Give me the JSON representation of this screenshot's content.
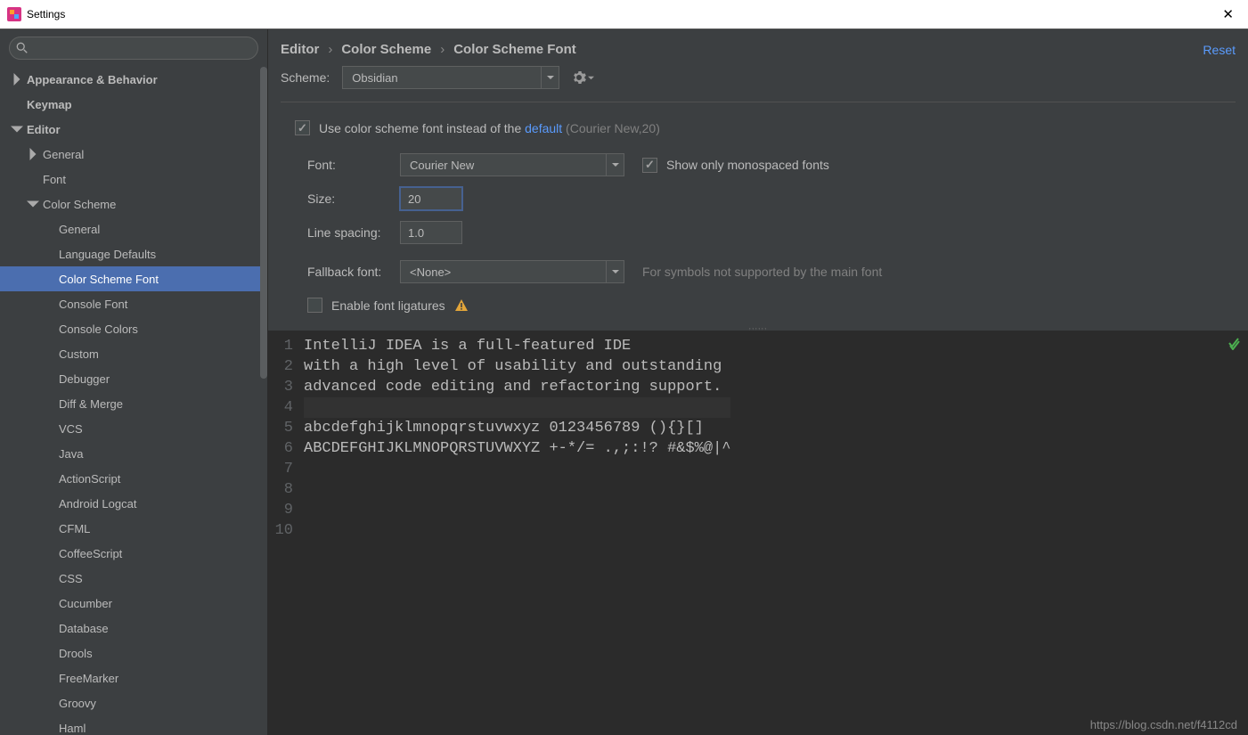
{
  "window": {
    "title": "Settings"
  },
  "sidebar": {
    "items": [
      {
        "label": "Appearance & Behavior",
        "indent": 0,
        "bold": true,
        "arrow": "right"
      },
      {
        "label": "Keymap",
        "indent": 0,
        "bold": true,
        "arrow": "none"
      },
      {
        "label": "Editor",
        "indent": 0,
        "bold": true,
        "arrow": "down"
      },
      {
        "label": "General",
        "indent": 1,
        "bold": false,
        "arrow": "right"
      },
      {
        "label": "Font",
        "indent": 1,
        "bold": false,
        "arrow": "none"
      },
      {
        "label": "Color Scheme",
        "indent": 1,
        "bold": false,
        "arrow": "down"
      },
      {
        "label": "General",
        "indent": 2,
        "bold": false,
        "arrow": "none"
      },
      {
        "label": "Language Defaults",
        "indent": 2,
        "bold": false,
        "arrow": "none"
      },
      {
        "label": "Color Scheme Font",
        "indent": 2,
        "bold": false,
        "arrow": "none",
        "selected": true
      },
      {
        "label": "Console Font",
        "indent": 2,
        "bold": false,
        "arrow": "none"
      },
      {
        "label": "Console Colors",
        "indent": 2,
        "bold": false,
        "arrow": "none"
      },
      {
        "label": "Custom",
        "indent": 2,
        "bold": false,
        "arrow": "none"
      },
      {
        "label": "Debugger",
        "indent": 2,
        "bold": false,
        "arrow": "none"
      },
      {
        "label": "Diff & Merge",
        "indent": 2,
        "bold": false,
        "arrow": "none"
      },
      {
        "label": "VCS",
        "indent": 2,
        "bold": false,
        "arrow": "none"
      },
      {
        "label": "Java",
        "indent": 2,
        "bold": false,
        "arrow": "none"
      },
      {
        "label": "ActionScript",
        "indent": 2,
        "bold": false,
        "arrow": "none"
      },
      {
        "label": "Android Logcat",
        "indent": 2,
        "bold": false,
        "arrow": "none"
      },
      {
        "label": "CFML",
        "indent": 2,
        "bold": false,
        "arrow": "none"
      },
      {
        "label": "CoffeeScript",
        "indent": 2,
        "bold": false,
        "arrow": "none"
      },
      {
        "label": "CSS",
        "indent": 2,
        "bold": false,
        "arrow": "none"
      },
      {
        "label": "Cucumber",
        "indent": 2,
        "bold": false,
        "arrow": "none"
      },
      {
        "label": "Database",
        "indent": 2,
        "bold": false,
        "arrow": "none"
      },
      {
        "label": "Drools",
        "indent": 2,
        "bold": false,
        "arrow": "none"
      },
      {
        "label": "FreeMarker",
        "indent": 2,
        "bold": false,
        "arrow": "none"
      },
      {
        "label": "Groovy",
        "indent": 2,
        "bold": false,
        "arrow": "none"
      },
      {
        "label": "Haml",
        "indent": 2,
        "bold": false,
        "arrow": "none"
      }
    ]
  },
  "breadcrumb": {
    "a": "Editor",
    "b": "Color Scheme",
    "c": "Color Scheme Font"
  },
  "reset_label": "Reset",
  "scheme": {
    "label": "Scheme:",
    "value": "Obsidian"
  },
  "use_scheme_font": {
    "prefix": "Use color scheme font instead of the ",
    "link": "default",
    "suffix": " (Courier New,20)"
  },
  "font": {
    "label": "Font:",
    "value": "Courier New"
  },
  "monospaced": {
    "label": "Show only monospaced fonts"
  },
  "size": {
    "label": "Size:",
    "value": "20"
  },
  "line_spacing": {
    "label": "Line spacing:",
    "value": "1.0"
  },
  "fallback": {
    "label": "Fallback font:",
    "value": "<None>",
    "help": "For symbols not supported by the main font"
  },
  "ligatures": {
    "label": "Enable font ligatures"
  },
  "preview": {
    "lines": [
      "IntelliJ IDEA is a full-featured IDE",
      "with a high level of usability and outstanding",
      "advanced code editing and refactoring support.",
      "",
      "abcdefghijklmnopqrstuvwxyz 0123456789 (){}[]",
      "ABCDEFGHIJKLMNOPQRSTUVWXYZ +-*/= .,;:!? #&$%@|^",
      "",
      "",
      "",
      ""
    ]
  },
  "watermark": "https://blog.csdn.net/f4112cd"
}
